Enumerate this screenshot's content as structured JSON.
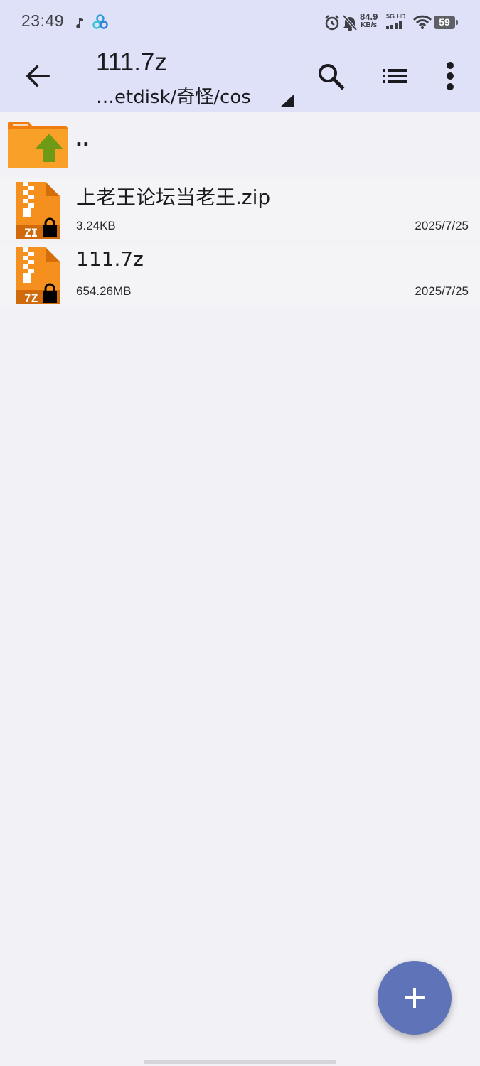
{
  "status_bar": {
    "time": "23:49",
    "speed_value": "84.9",
    "speed_unit": "KB/s",
    "network": "5G HD",
    "battery": "59"
  },
  "toolbar": {
    "title": "111.7z",
    "path": "…etdisk/奇怪/cos"
  },
  "list": {
    "parent_label": "..",
    "files": [
      {
        "name": "上老王论坛当老王.zip",
        "size": "3.24KB",
        "date": "2025/7/25",
        "badge": "ZIP"
      },
      {
        "name": "111.7z",
        "size": "654.26MB",
        "date": "2025/7/25",
        "badge": "7Z"
      }
    ]
  },
  "colors": {
    "header_bg": "#dfe1f8",
    "page_bg": "#f2f1f6",
    "folder_orange": "#f79a1f",
    "archive_orange": "#f5901e",
    "fab": "#5f73b8",
    "up_arrow_green": "#6f9a16"
  },
  "icons": [
    "back-arrow-icon",
    "search-icon",
    "list-view-icon",
    "more-vert-icon",
    "folder-up-icon",
    "archive-zip-icon",
    "lock-icon",
    "add-icon"
  ]
}
